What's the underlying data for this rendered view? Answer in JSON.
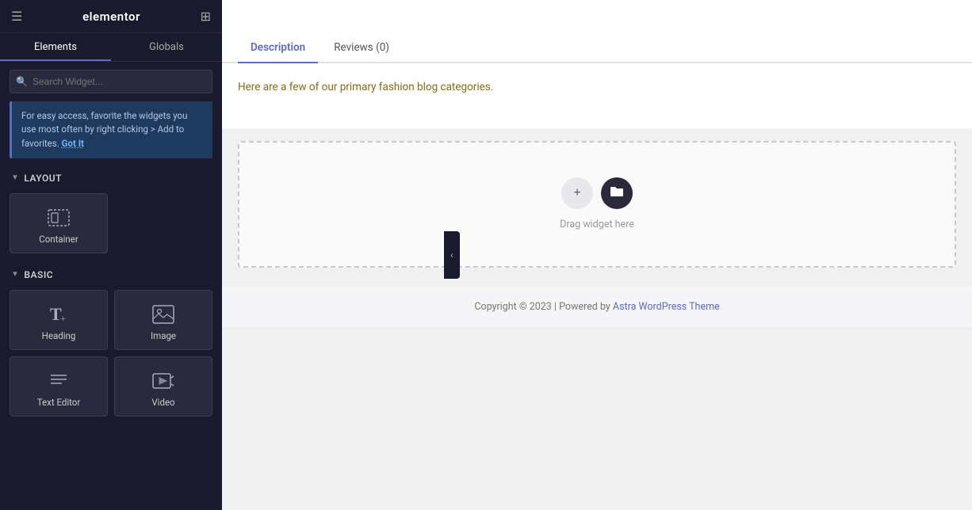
{
  "header": {
    "title": "elementor",
    "hamburger_icon": "☰",
    "grid_icon": "⋮⋮"
  },
  "tabs": {
    "elements_label": "Elements",
    "globals_label": "Globals",
    "active": "Elements"
  },
  "search": {
    "placeholder": "Search Widget..."
  },
  "tip": {
    "text": "For easy access, favorite the widgets you use most often by right clicking > Add to favorites.",
    "got_it_label": "Got It"
  },
  "layout_section": {
    "label": "Layout",
    "widgets": [
      {
        "id": "container",
        "label": "Container",
        "icon": "container"
      }
    ]
  },
  "basic_section": {
    "label": "Basic",
    "widgets": [
      {
        "id": "heading",
        "label": "Heading",
        "icon": "heading"
      },
      {
        "id": "image",
        "label": "Image",
        "icon": "image"
      },
      {
        "id": "text-editor",
        "label": "Text Editor",
        "icon": "text-editor"
      },
      {
        "id": "video",
        "label": "Video",
        "icon": "video"
      }
    ]
  },
  "product_tabs": [
    {
      "id": "description",
      "label": "Description",
      "active": true
    },
    {
      "id": "reviews",
      "label": "Reviews (0)",
      "active": false
    }
  ],
  "description": {
    "text": "Here are a few of our primary fashion blog categories."
  },
  "drop_zone": {
    "text": "Drag widget here",
    "add_icon": "+",
    "folder_icon": "▪"
  },
  "footer": {
    "text_before_link": "Copyright © 2023 | Powered by ",
    "link_text": "Astra WordPress Theme",
    "text_after_link": ""
  },
  "collapse_btn_icon": "‹"
}
